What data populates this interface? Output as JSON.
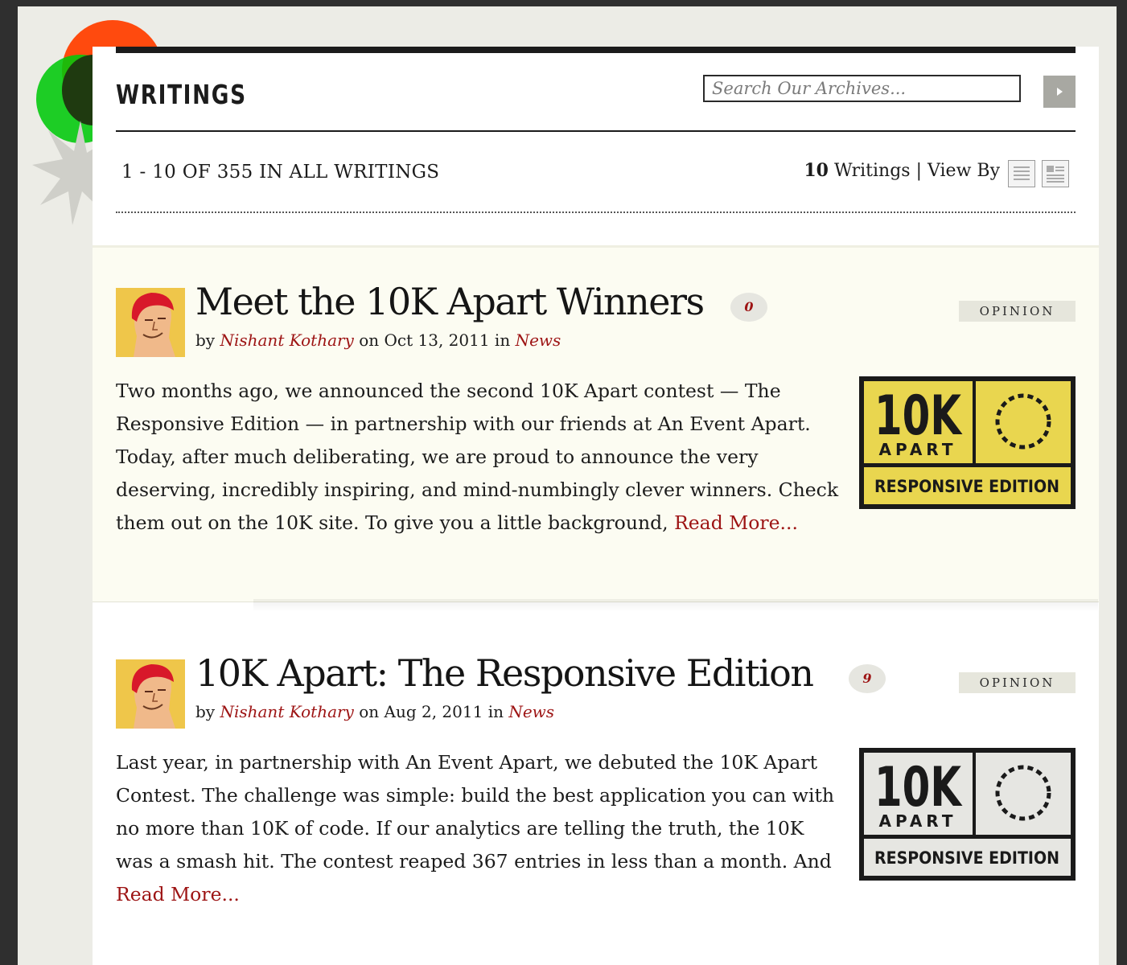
{
  "header": {
    "title": "WRITINGS",
    "search": {
      "placeholder": "Search Our Archives...",
      "value": ""
    },
    "search_button_icon": "arrow-right-icon"
  },
  "listing": {
    "summary": "1 - 10 OF 355 IN ALL WRITINGS",
    "per_page": "10",
    "per_page_suffix": "Writings",
    "view_by_label": "View By",
    "view_options": [
      "list-view-icon",
      "excerpt-view-icon"
    ]
  },
  "posts": [
    {
      "title": "Meet the 10K Apart Winners",
      "comments": "0",
      "by": "by",
      "author": "Nishant Kothary",
      "on": "on",
      "date": "Oct 13, 2011",
      "in": "in",
      "section": "News",
      "category": "OPINION",
      "excerpt": "Two months ago, we announced the second 10K Apart contest — The Responsive Edition — in partnership with our friends at An Event Apart. Today, after much deliberating, we are proud to announce the very deserving, incredibly inspiring, and mind-numbingly clever winners. Check them out on the 10K site. To give you a little background, ",
      "read_more": "Read More...",
      "thumb": {
        "big": "10K",
        "small": "APART",
        "edition": "RESPONSIVE EDITION",
        "color": "#e9d64f"
      }
    },
    {
      "title": "10K Apart: The Responsive Edition",
      "comments": "9",
      "by": "by",
      "author": "Nishant Kothary",
      "on": "on",
      "date": "Aug 2, 2011",
      "in": "in",
      "section": "News",
      "category": "OPINION",
      "excerpt": "Last year, in partnership with An Event Apart, we debuted the 10K Apart Contest. The challenge was simple: build the best application you can with no more than 10K of code. If our analytics are telling the truth, the 10K was a smash hit. The contest reaped 367 entries in less than a month. And ",
      "read_more": "Read More...",
      "thumb": {
        "big": "10K",
        "small": "APART",
        "edition": "RESPONSIVE EDITION",
        "color": "#e6e6e2"
      }
    }
  ],
  "colors": {
    "accent_red": "#9d1414",
    "orange_circle": "#ff4a0e",
    "green_circle": "#00c80a",
    "frame_dark": "#2f2f2f"
  }
}
